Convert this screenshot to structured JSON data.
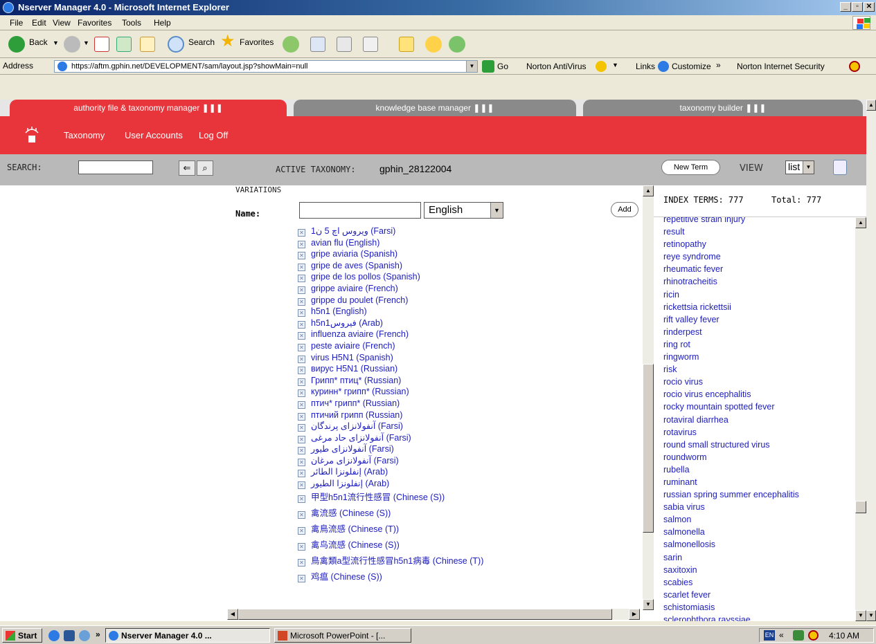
{
  "window": {
    "title": "Nserver Manager 4.0 - Microsoft Internet Explorer"
  },
  "menu": [
    "File",
    "Edit",
    "View",
    "Favorites",
    "Tools",
    "Help"
  ],
  "toolbar": {
    "back": "Back",
    "search": "Search",
    "favorites": "Favorites"
  },
  "addressbar": {
    "label": "Address",
    "url": "https://aftm.gphin.net/DEVELOPMENT/sam/layout.jsp?showMain=null",
    "go": "Go",
    "norton_antivirus": "Norton AntiVirus",
    "links": "Links",
    "customize": "Customize",
    "norton_security": "Norton Internet Security"
  },
  "tabs": {
    "t1": "authority file & taxonomy manager ❚❚❚",
    "t2": "knowledge base manager ❚❚❚",
    "t3": "taxonomy builder ❚❚❚"
  },
  "nav": {
    "taxonomy": "Taxonomy",
    "users": "User Accounts",
    "logoff": "Log Off"
  },
  "search": {
    "label": "SEARCH:",
    "active_label": "ACTIVE TAXONOMY:",
    "active_value": "gphin_28122004",
    "new_term": "New Term",
    "view_label": "VIEW",
    "view_value": "list"
  },
  "variations": {
    "heading": "VARIATIONS",
    "name_label": "Name:",
    "language": "English",
    "add": "Add",
    "items": [
      "ویروس اچ 5 ن1  (Farsi)",
      "avian flu  (English)",
      "gripe aviaria  (Spanish)",
      "gripe de aves  (Spanish)",
      "gripe de los pollos  (Spanish)",
      "grippe aviaire  (French)",
      "grippe du poulet  (French)",
      "h5n1  (English)",
      "h5n1فيروس  (Arab)",
      "influenza aviaire  (French)",
      "peste aviaire  (French)",
      "virus H5N1  (Spanish)",
      "вирус H5N1  (Russian)",
      "Грипп* птиц*  (Russian)",
      "куринн* грипп*  (Russian)",
      "птич* грипп*  (Russian)",
      "птичий грипп  (Russian)",
      "آنفولانزای پرندگان  (Farsi)",
      "آنفولانزای حاد مرغی  (Farsi)",
      "آنفولانزای طیور  (Farsi)",
      "آنفولانزای مرغان  (Farsi)",
      "إنفلونزا الطائر  (Arab)",
      "إنفلونزا الطيور  (Arab)",
      "甲型h5n1流行性感冒  (Chinese (S))",
      "禽流感  (Chinese (S))",
      "禽鳥流感  (Chinese (T))",
      "禽鸟流感  (Chinese (S))",
      "鳥禽類a型流行性感冒h5n1病毒  (Chinese (T))",
      "鸡瘟  (Chinese (S))"
    ]
  },
  "index": {
    "label": "INDEX TERMS: 777",
    "total": "Total: 777",
    "terms": [
      "repetitive strain injury",
      "result",
      "retinopathy",
      "reye syndrome",
      "rheumatic fever",
      "rhinotracheitis",
      "ricin",
      "rickettsia rickettsii",
      "rift valley fever",
      "rinderpest",
      "ring rot",
      "ringworm",
      "risk",
      "rocio virus",
      "rocio virus encephalitis",
      "rocky mountain spotted fever",
      "rotaviral diarrhea",
      "rotavirus",
      "round small structured virus",
      "roundworm",
      "rubella",
      "ruminant",
      "russian spring summer encephalitis",
      "sabia virus",
      "salmon",
      "salmonella",
      "salmonellosis",
      "sarin",
      "saxitoxin",
      "scabies",
      "scarlet fever",
      "schistomiasis",
      "sclerophthora rayssiae"
    ]
  },
  "taskbar": {
    "start": "Start",
    "more": "»",
    "item1": "Nserver Manager 4.0 ...",
    "item2": "Microsoft PowerPoint - [...",
    "lang": "EN",
    "chev": "«",
    "time": "4:10 AM"
  }
}
